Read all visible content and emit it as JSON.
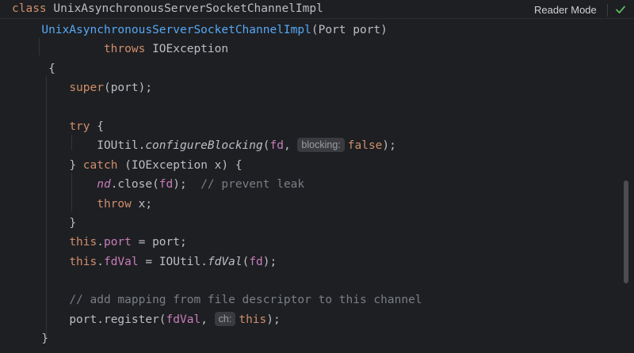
{
  "sticky_header": {
    "keyword": "class",
    "class_name": "UnixAsynchronousServerSocketChannelImpl"
  },
  "toolbar": {
    "reader_mode_label": "Reader Mode",
    "status_icon": "checkmark-icon"
  },
  "colors": {
    "background": "#1e1f22",
    "keyword": "#cf8e6d",
    "method": "#56a8f5",
    "field": "#c77dbb",
    "comment": "#7a7e85",
    "text": "#bcbec4",
    "check": "#5fb865"
  },
  "code": {
    "line1": {
      "ctor": "UnixAsynchronousServerSocketChannelImpl",
      "params": "(Port port)"
    },
    "line2": {
      "throws": "throws",
      "exc": "IOException"
    },
    "line3": {
      "brace": "{"
    },
    "line4": {
      "super": "super",
      "rest": "(port);"
    },
    "line6": {
      "try": "try",
      "rest": " {"
    },
    "line7": {
      "cls": "IOUtil.",
      "method": "configureBlocking",
      "open": "(",
      "arg1": "fd",
      "comma": ", ",
      "hint": "blocking:",
      "arg2": "false",
      "close": ");"
    },
    "line8": {
      "close_brace": "} ",
      "catch": "catch",
      "rest": " (IOException x) {"
    },
    "line9": {
      "obj": "nd",
      "mid": ".close(",
      "arg": "fd",
      "end": ");",
      "comment": "  // prevent leak"
    },
    "line10": {
      "throw": "throw",
      "rest": " x;"
    },
    "line11": {
      "brace": "}"
    },
    "line12": {
      "this": "this",
      "dot": ".",
      "field": "port",
      "rest": " = port;"
    },
    "line13": {
      "this": "this",
      "dot": ".",
      "field": "fdVal",
      "mid": " = IOUtil.",
      "method": "fdVal",
      "open": "(",
      "arg": "fd",
      "end": ");"
    },
    "line15": {
      "comment": "// add mapping from file descriptor to this channel"
    },
    "line16": {
      "start": "port.register(",
      "arg1": "fdVal",
      "comma": ", ",
      "hint": "ch:",
      "this": "this",
      "end": ");"
    },
    "line17": {
      "brace": "}"
    }
  }
}
